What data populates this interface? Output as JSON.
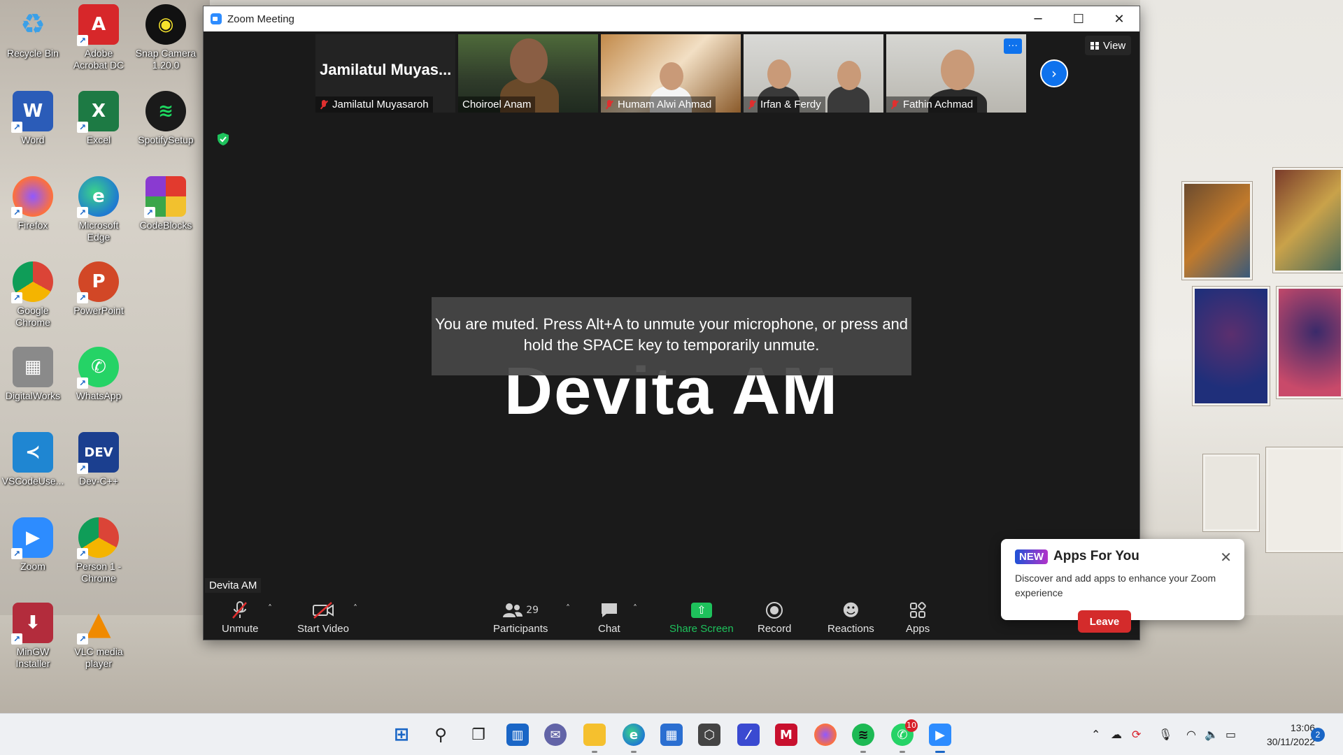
{
  "desktop": {
    "icons": [
      {
        "label": "Recycle Bin",
        "icon": "recycle-bin-icon"
      },
      {
        "label": "Adobe Acrobat DC",
        "icon": "acrobat-icon"
      },
      {
        "label": "Snap Camera 1.20.0",
        "icon": "snap-camera-icon"
      },
      {
        "label": "Word",
        "icon": "word-icon"
      },
      {
        "label": "Excel",
        "icon": "excel-icon"
      },
      {
        "label": "SpotifySetup",
        "icon": "spotify-icon"
      },
      {
        "label": "Firefox",
        "icon": "firefox-icon"
      },
      {
        "label": "Microsoft Edge",
        "icon": "edge-icon"
      },
      {
        "label": "CodeBlocks",
        "icon": "codeblocks-icon"
      },
      {
        "label": "Google Chrome",
        "icon": "chrome-icon"
      },
      {
        "label": "PowerPoint",
        "icon": "powerpoint-icon"
      },
      {
        "label": "DigitalWorks",
        "icon": "chip-icon"
      },
      {
        "label": "WhatsApp",
        "icon": "whatsapp-icon"
      },
      {
        "label": "VSCodeUse...",
        "icon": "vscode-icon"
      },
      {
        "label": "Dev-C++",
        "icon": "devcpp-icon"
      },
      {
        "label": "Zoom",
        "icon": "zoom-icon"
      },
      {
        "label": "Person 1 - Chrome",
        "icon": "chrome-profile-icon"
      },
      {
        "label": "MinGW Installer",
        "icon": "installer-icon"
      },
      {
        "label": "VLC media player",
        "icon": "vlc-icon"
      }
    ]
  },
  "window": {
    "title": "Zoom Meeting",
    "minimize": "─",
    "maximize": "☐",
    "close": "✕"
  },
  "meeting": {
    "thumbnails": [
      {
        "big_name": "Jamilatul  Muyas...",
        "name": "Jamilatul Muyasaroh",
        "muted": true
      },
      {
        "name": "Choiroel Anam",
        "muted": false
      },
      {
        "name": "Humam Alwi Ahmad",
        "muted": true
      },
      {
        "name": "Irfan & Ferdy",
        "muted": true
      },
      {
        "name": "Fathin Achmad",
        "muted": true,
        "more": "···"
      }
    ],
    "next_arrow": "›",
    "view_label": "View",
    "active_speaker": "Devita AM",
    "mute_toast": "You are muted. Press Alt+A to unmute your microphone, or press and hold the SPACE key to temporarily unmute.",
    "self_label": "Devita AM"
  },
  "toolbar": {
    "unmute": "Unmute",
    "start_video": "Start Video",
    "participants": "Participants",
    "participant_count": "29",
    "chat": "Chat",
    "share_screen": "Share Screen",
    "record": "Record",
    "reactions": "Reactions",
    "apps": "Apps",
    "leave": "Leave",
    "caret": "˄"
  },
  "apps_popup": {
    "badge": "NEW",
    "title": "Apps For You",
    "body": "Discover and add apps to enhance your Zoom experience",
    "close": "✕"
  },
  "taskbar": {
    "apps": [
      "start-icon",
      "search-icon",
      "task-view-icon",
      "widgets-icon",
      "teams-chat-icon",
      "file-explorer-icon",
      "edge-icon",
      "store-icon",
      "unity-icon",
      "terminal-icon",
      "mcafee-icon",
      "firefox-icon",
      "spotify-icon",
      "whatsapp-icon",
      "zoom-icon"
    ],
    "whatsapp_badge": "10",
    "time": "13:06",
    "date": "30/11/2022",
    "notification_count": "2"
  },
  "colors": {
    "zoom_blue": "#0e72ed",
    "share_green": "#1ec25c",
    "leave_red": "#d42b2b",
    "meeting_bg": "#1a1a1a"
  }
}
